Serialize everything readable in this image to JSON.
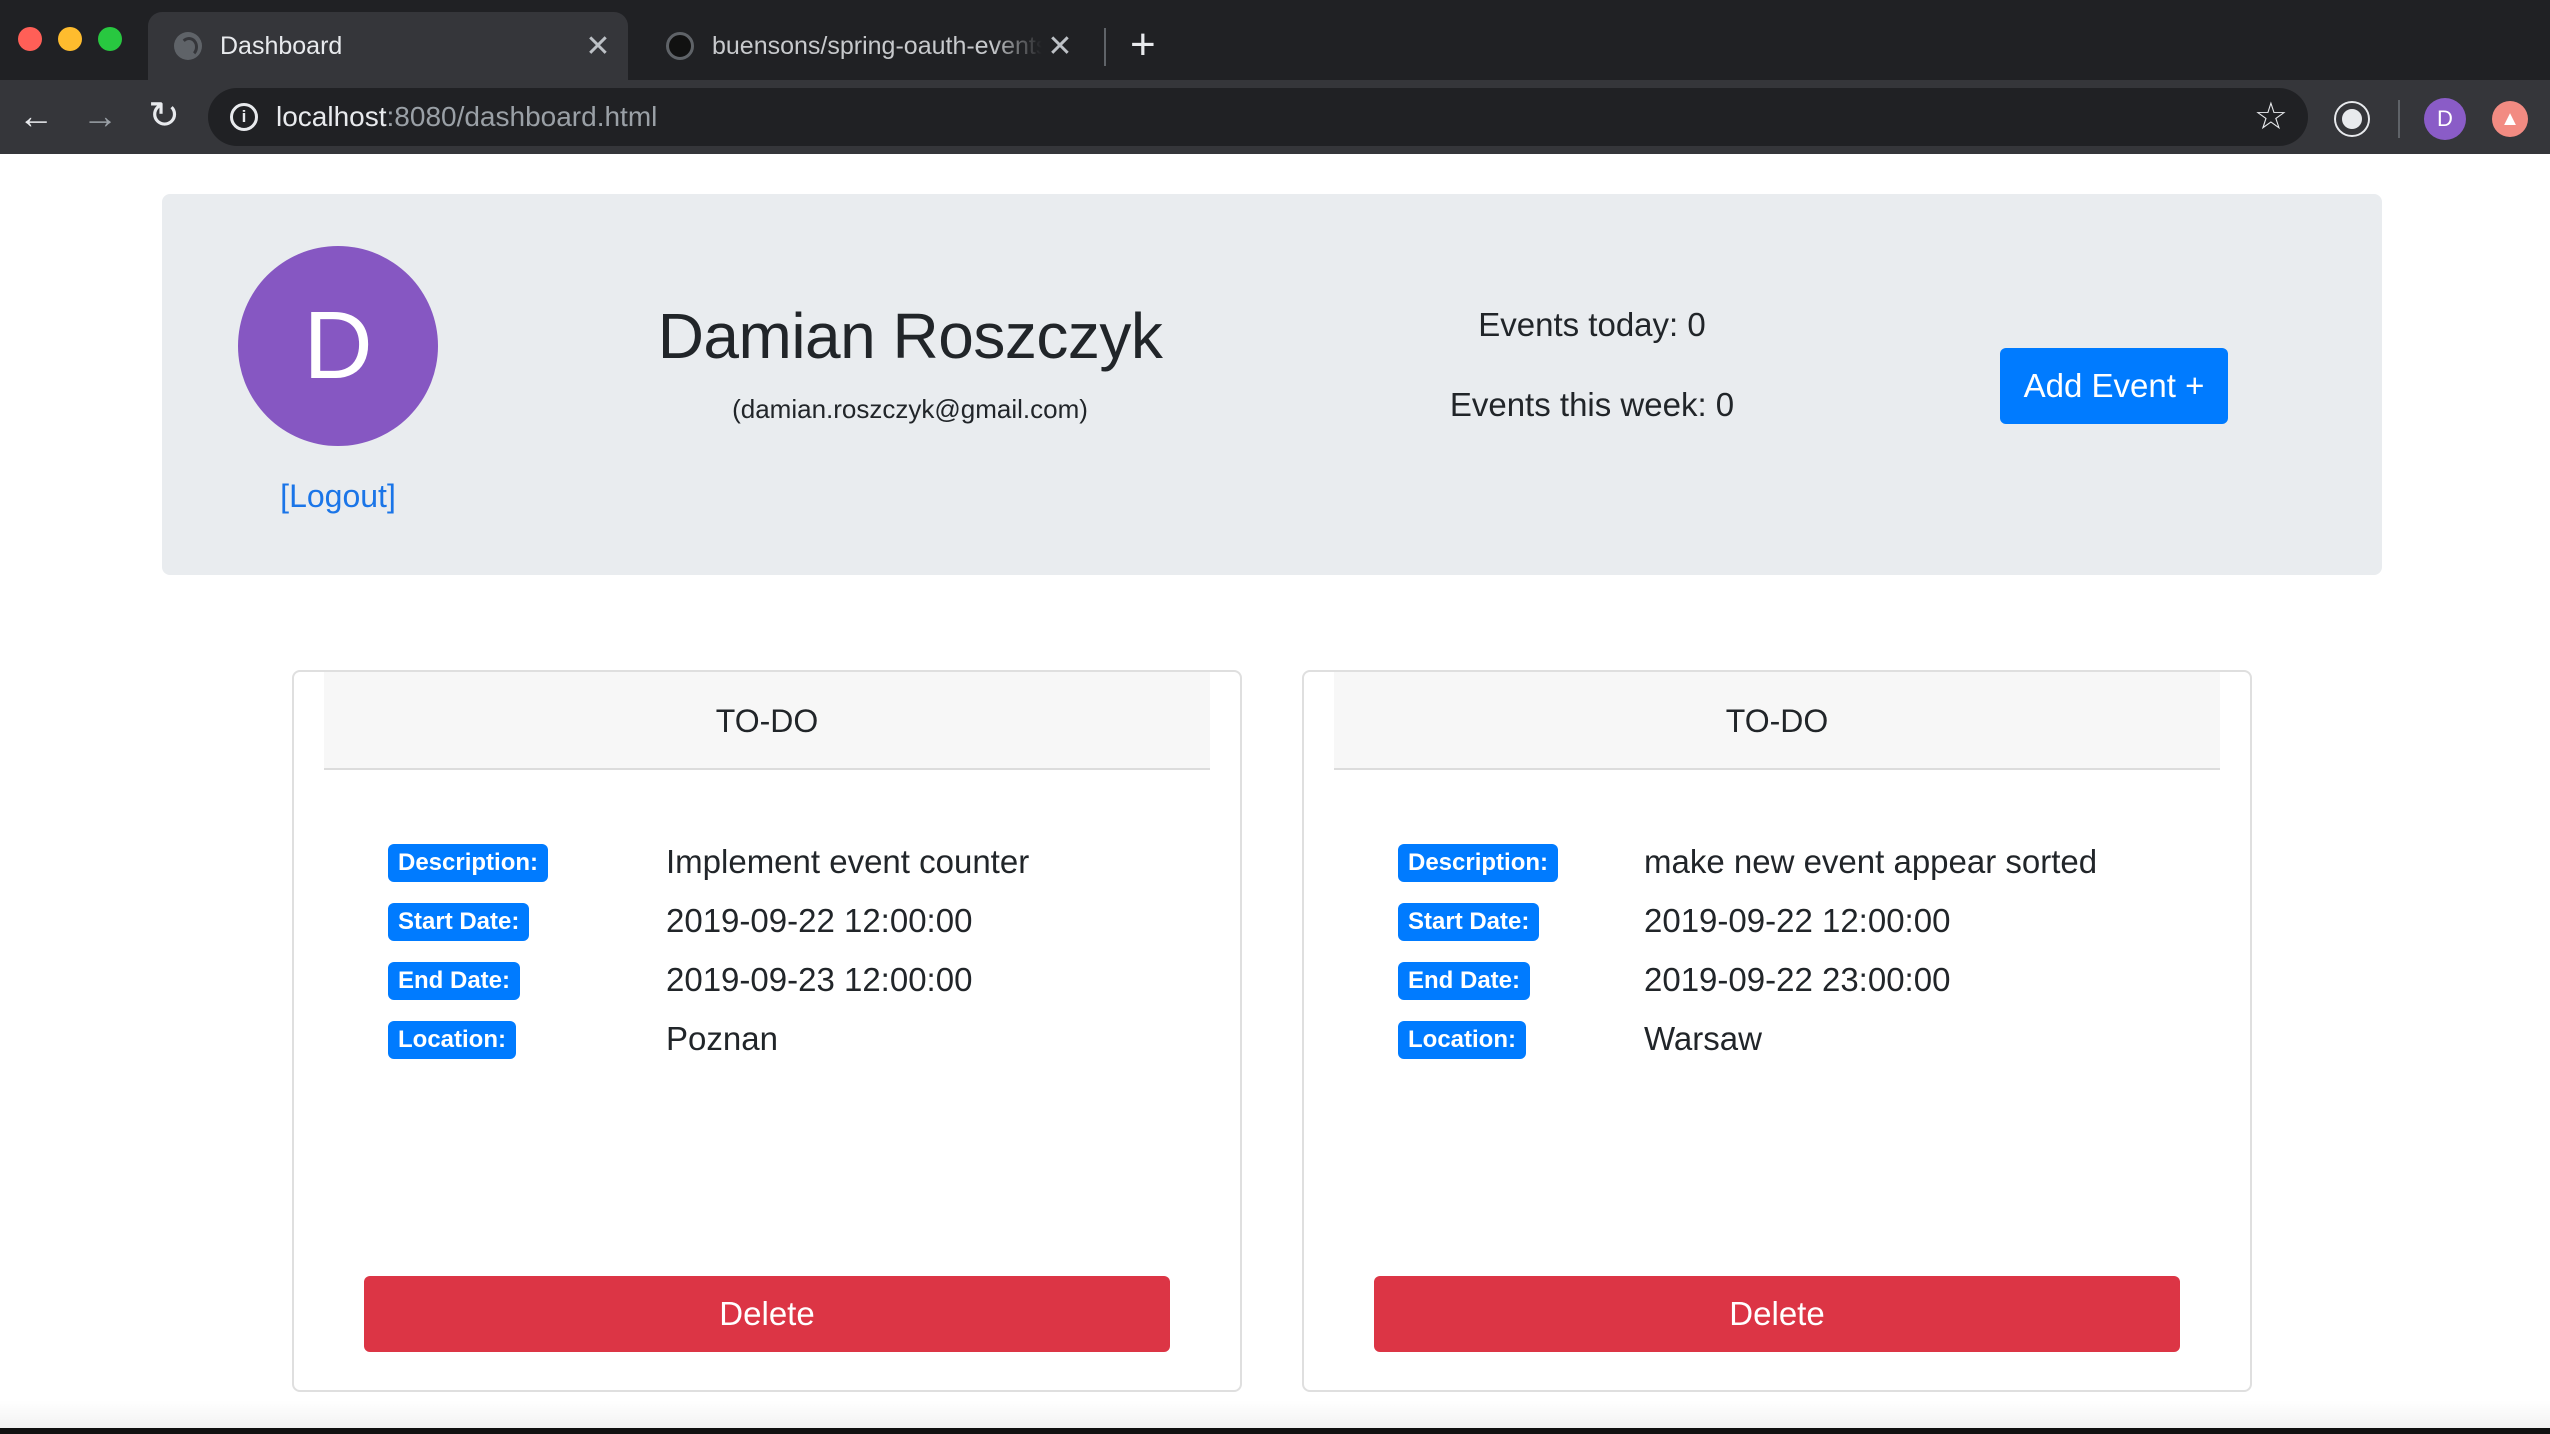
{
  "browser": {
    "tabs": [
      {
        "title": "Dashboard",
        "active": true
      },
      {
        "title": "buensons/spring-oauth-events",
        "active": false
      }
    ],
    "url_host": "localhost",
    "url_rest": ":8080/dashboard.html",
    "profile_initial": "D"
  },
  "header": {
    "avatar_initial": "D",
    "logout_label": "[Logout]",
    "user_name": "Damian Roszczyk",
    "user_email": "(damian.roszczyk@gmail.com)",
    "events_today": "Events today: 0",
    "events_week": "Events this week: 0",
    "add_event_label": "Add Event +"
  },
  "labels": {
    "description": "Description:",
    "start_date": "Start Date:",
    "end_date": "End Date:",
    "location": "Location:",
    "delete": "Delete"
  },
  "events": [
    {
      "status": "TO-DO",
      "description": "Implement event counter",
      "start_date": "2019-09-22 12:00:00",
      "end_date": "2019-09-23 12:00:00",
      "location": "Poznan"
    },
    {
      "status": "TO-DO",
      "description": "make new event appear sorted",
      "start_date": "2019-09-22 12:00:00",
      "end_date": "2019-09-22 23:00:00",
      "location": "Warsaw"
    }
  ],
  "colors": {
    "primary": "#007bff",
    "danger": "#dc3545",
    "avatar": "#8657c2",
    "jumbotron": "#e9ecef"
  }
}
